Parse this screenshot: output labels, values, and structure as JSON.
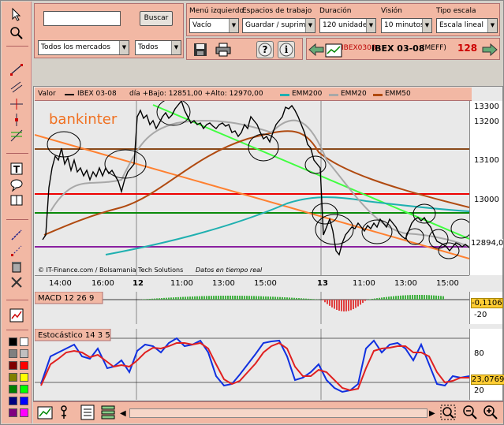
{
  "search": {
    "placeholder": "",
    "button": "Buscar"
  },
  "markets": {
    "selected": "Todos los mercados",
    "type": "Todos"
  },
  "menu_izquierdo": {
    "label": "Menú izquierdo",
    "value": "Vacío"
  },
  "espacios": {
    "label": "Espacios de trabajo",
    "value": "Guardar / suprimir"
  },
  "duracion": {
    "label": "Duración",
    "value": "120 unidades"
  },
  "vision": {
    "label": "Visión",
    "value": "10 minutos"
  },
  "tipo_escala": {
    "label": "Tipo escala",
    "value": "Escala lineal"
  },
  "instrument": {
    "code": "IBEX0308",
    "name": "IBEX 03-08",
    "exchange": "(MEFF)",
    "value": "128"
  },
  "legend": {
    "valor": "Valor",
    "series": "IBEX 03-08",
    "info": "día +Bajo: 12851,00 +Alto: 12970,00",
    "emm200": "EMM200",
    "emm20": "EMM20",
    "emm50": "EMM50"
  },
  "brand": "bankinter",
  "footer": {
    "left": "© IT-Finance.com / Bolsamania Tech Solutions",
    "right": "Datos en tiempo real"
  },
  "price_axis": {
    "labels": [
      "13300",
      "13200",
      "13100",
      "13000",
      "12894,0"
    ]
  },
  "time_axis": {
    "labels": [
      "14:00",
      "16:00",
      "12",
      "11:00",
      "13:00",
      "15:00",
      "13",
      "11:00",
      "13:00",
      "15:00"
    ]
  },
  "macd": {
    "label": "MACD 12 26 9",
    "value": "-0,1106",
    "tick": "-20"
  },
  "stoch": {
    "label": "Estocástico 14 3 5",
    "value": "23,0769",
    "ticks": [
      "80",
      "20"
    ]
  },
  "colors": {
    "panel": "#f2b8a4",
    "chart_bg": "#e9e9e9",
    "emm200": "#1fb0b0",
    "emm20": "#a8a8a8",
    "emm50": "#b04a10",
    "price": "#000000"
  },
  "icons": [
    "cursor-icon",
    "zoom-icon",
    "trendline-icon",
    "parallel-icon",
    "fibonacci-icon",
    "text-tool-icon",
    "comment-icon",
    "book-icon",
    "delete-icon",
    "save-icon",
    "print-icon",
    "help-icon",
    "info-icon",
    "prev-arrow-icon",
    "next-arrow-icon",
    "chart-icon"
  ]
}
